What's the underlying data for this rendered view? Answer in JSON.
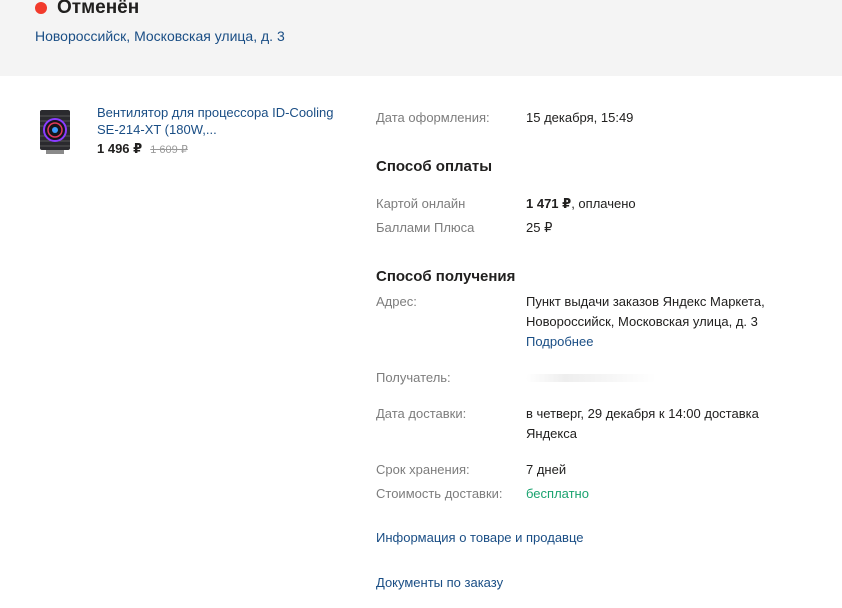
{
  "status": {
    "label": "Отменён",
    "dot_color": "#f23b2c",
    "address": "Новороссийск, Московская улица, д. 3"
  },
  "product": {
    "title_line1": "Вентилятор для процессора ID-Cooling",
    "title_line2": "SE-214-XT (180W,...",
    "price": "1 496 ₽",
    "old_price": "1 609 ₽",
    "thumb_icon": "cpu-cooler-icon"
  },
  "order": {
    "date_label": "Дата оформления:",
    "date_value": "15 декабря, 15:49"
  },
  "payment": {
    "heading": "Способ оплаты",
    "card_label": "Картой онлайн",
    "card_amount": "1 471 ₽",
    "card_suffix": ", оплачено",
    "points_label": "Баллами Плюса",
    "points_value": "25 ₽"
  },
  "delivery": {
    "heading": "Способ получения",
    "address_label": "Адрес:",
    "address_line1": "Пункт выдачи заказов Яндекс Маркета,",
    "address_line2": "Новороссийск, Московская улица, д. 3",
    "more_link": "Подробнее",
    "recipient_label": "Получатель:",
    "date_label": "Дата доставки:",
    "date_line1": "в четверг, 29 декабря к 14:00 доставка",
    "date_line2": "Яндекса",
    "storage_label": "Срок хранения:",
    "storage_value": "7 дней",
    "cost_label": "Стоимость доставки:",
    "cost_value": "бесплатно"
  },
  "links": {
    "product_info": "Информация о товаре и продавце",
    "documents": "Документы по заказу"
  },
  "colors": {
    "link": "#1a4e85",
    "free_green": "#1aa36f",
    "muted": "#7d7d7d"
  }
}
